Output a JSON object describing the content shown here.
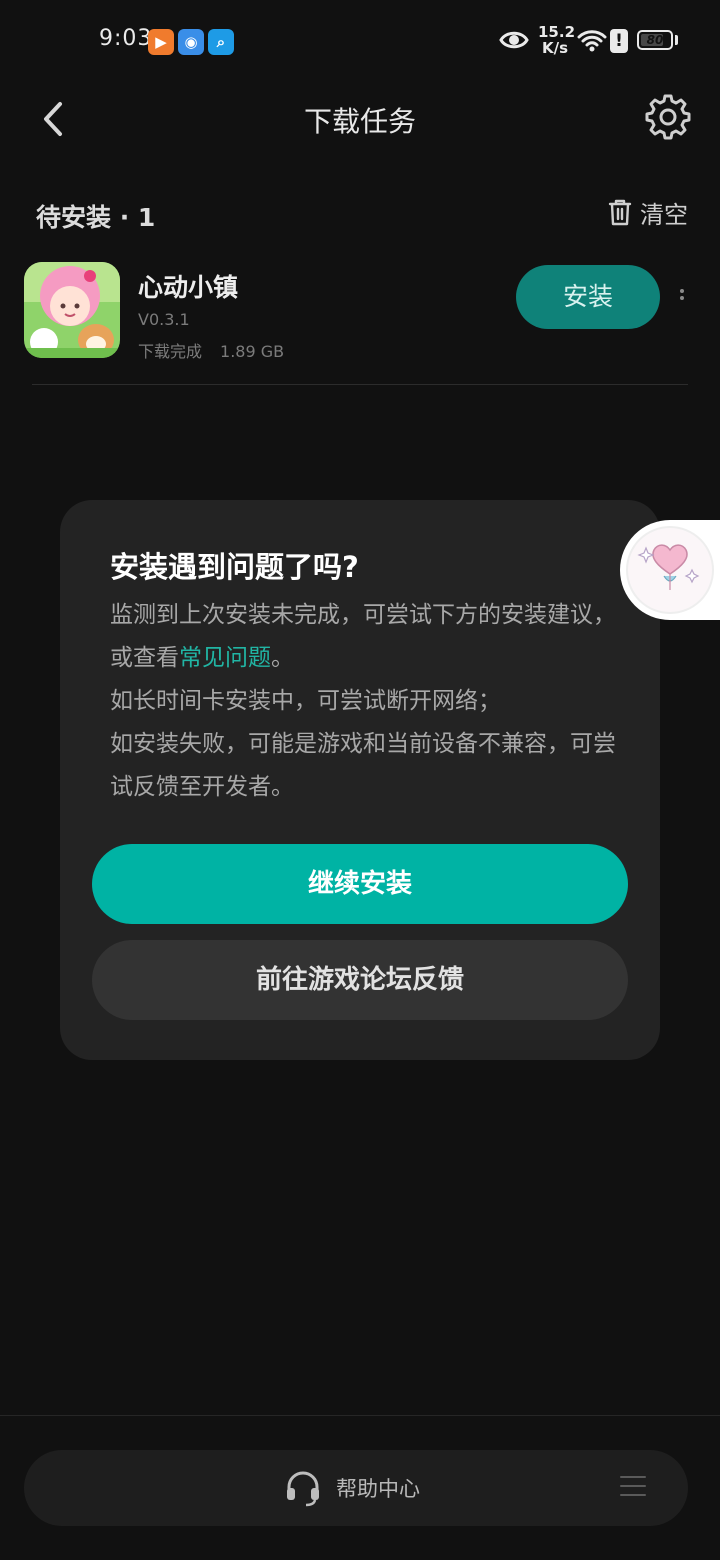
{
  "status_bar": {
    "time": "9:03",
    "speed_value": "15.2",
    "speed_unit": "K/s",
    "battery": "80",
    "battery_level": 0.8,
    "app_icons": [
      "video-app-icon",
      "browser-app-icon",
      "search-app-icon"
    ]
  },
  "header": {
    "title": "下载任务"
  },
  "pending": {
    "title": "待安装 · 1",
    "clear_label": "清空"
  },
  "app": {
    "name": "心动小镇",
    "version": "V0.3.1",
    "status": "下载完成",
    "size": "1.89 GB",
    "install_label": "安装"
  },
  "dialog": {
    "title": "安装遇到问题了吗?",
    "line1_pre": "监测到上次安装未完成，可尝试下方的安装建议，或查看",
    "faq_link": "常见问题",
    "line1_post": "。",
    "line2": "如长时间卡安装中，可尝试断开网络；",
    "line3": "如安装失败，可能是游戏和当前设备不兼容，可尝试反馈至开发者。",
    "continue_label": "继续安装",
    "forum_label": "前往游戏论坛反馈"
  },
  "bottom": {
    "help_label": "帮助中心"
  },
  "colors": {
    "accent": "#00b3a4",
    "install_button": "#0f8279",
    "link": "#21b5a4",
    "background": "#111111",
    "dialog": "#232323"
  }
}
